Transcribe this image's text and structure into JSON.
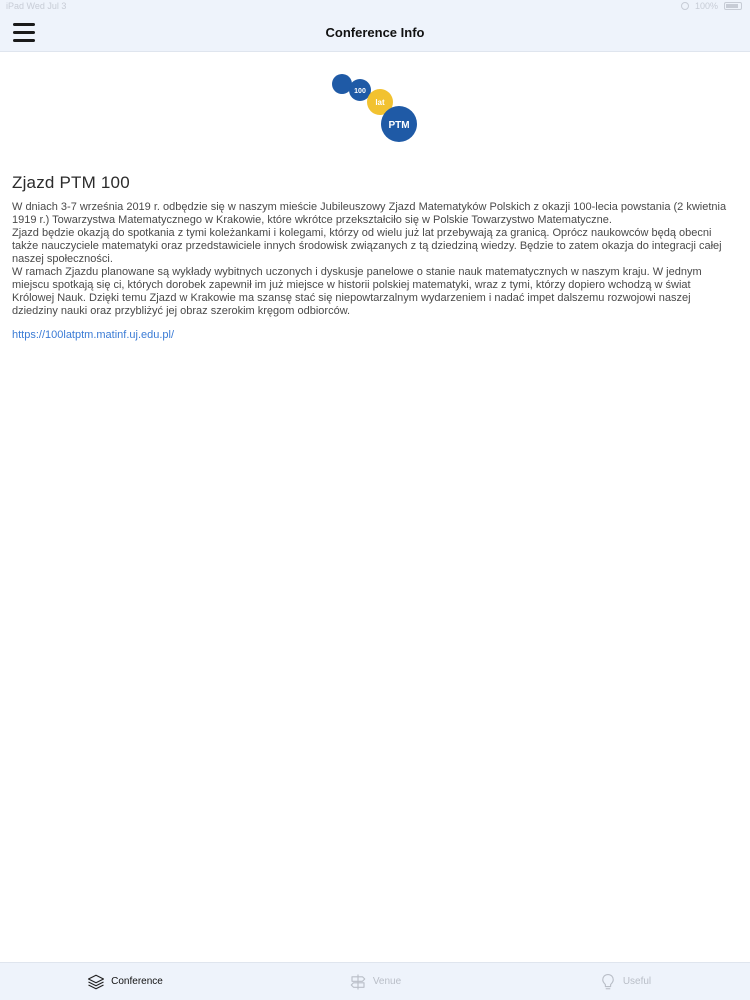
{
  "status": {
    "left": "iPad  Wed Jul 3",
    "right": "100%"
  },
  "nav": {
    "title": "Conference Info"
  },
  "logo": {
    "text_100": "100",
    "text_lat": "lat",
    "text_ptm": "PTM"
  },
  "article": {
    "title": "Zjazd PTM 100",
    "paragraphs": [
      "W dniach 3-7 września 2019 r. odbędzie się w naszym mieście Jubileuszowy Zjazd Matematyków Polskich z okazji 100-lecia powstania (2 kwietnia 1919 r.) Towarzystwa Matematycznego w Krakowie, które wkrótce przekształciło się w Polskie Towarzystwo Matematyczne.",
      "Zjazd będzie okazją do spotkania z tymi koleżankami i kolegami, którzy od wielu już lat przebywają za granicą. Oprócz naukowców będą obecni także nauczyciele matematyki oraz przedstawiciele innych środowisk związanych z tą dziedziną wiedzy. Będzie to zatem okazja do integracji całej naszej społeczności.",
      "W ramach Zjazdu planowane są wykłady wybitnych uczonych i dyskusje panelowe o stanie nauk matematycznych w naszym kraju. W jednym miejscu spotkają się ci, których dorobek zapewnił im już miejsce w historii polskiej matematyki, wraz z tymi, którzy dopiero wchodzą w świat Królowej Nauk. Dzięki temu Zjazd w Krakowie ma szansę stać się niepowtarzalnym wydarzeniem i nadać impet dalszemu rozwojowi naszej dziedziny nauki oraz przybliżyć jej obraz szerokim kręgom odbiorców."
    ],
    "link": "https://100latptm.matinf.uj.edu.pl/"
  },
  "tabs": [
    {
      "label": "Conference",
      "icon": "layers-icon",
      "active": true
    },
    {
      "label": "Venue",
      "icon": "signpost-icon",
      "active": false
    },
    {
      "label": "Useful",
      "icon": "lightbulb-icon",
      "active": false
    }
  ],
  "colors": {
    "accent": "#3a7bd5",
    "logo_blue": "#1f5aa6",
    "logo_yellow": "#f2c230",
    "bar_bg": "#eef3fb"
  }
}
